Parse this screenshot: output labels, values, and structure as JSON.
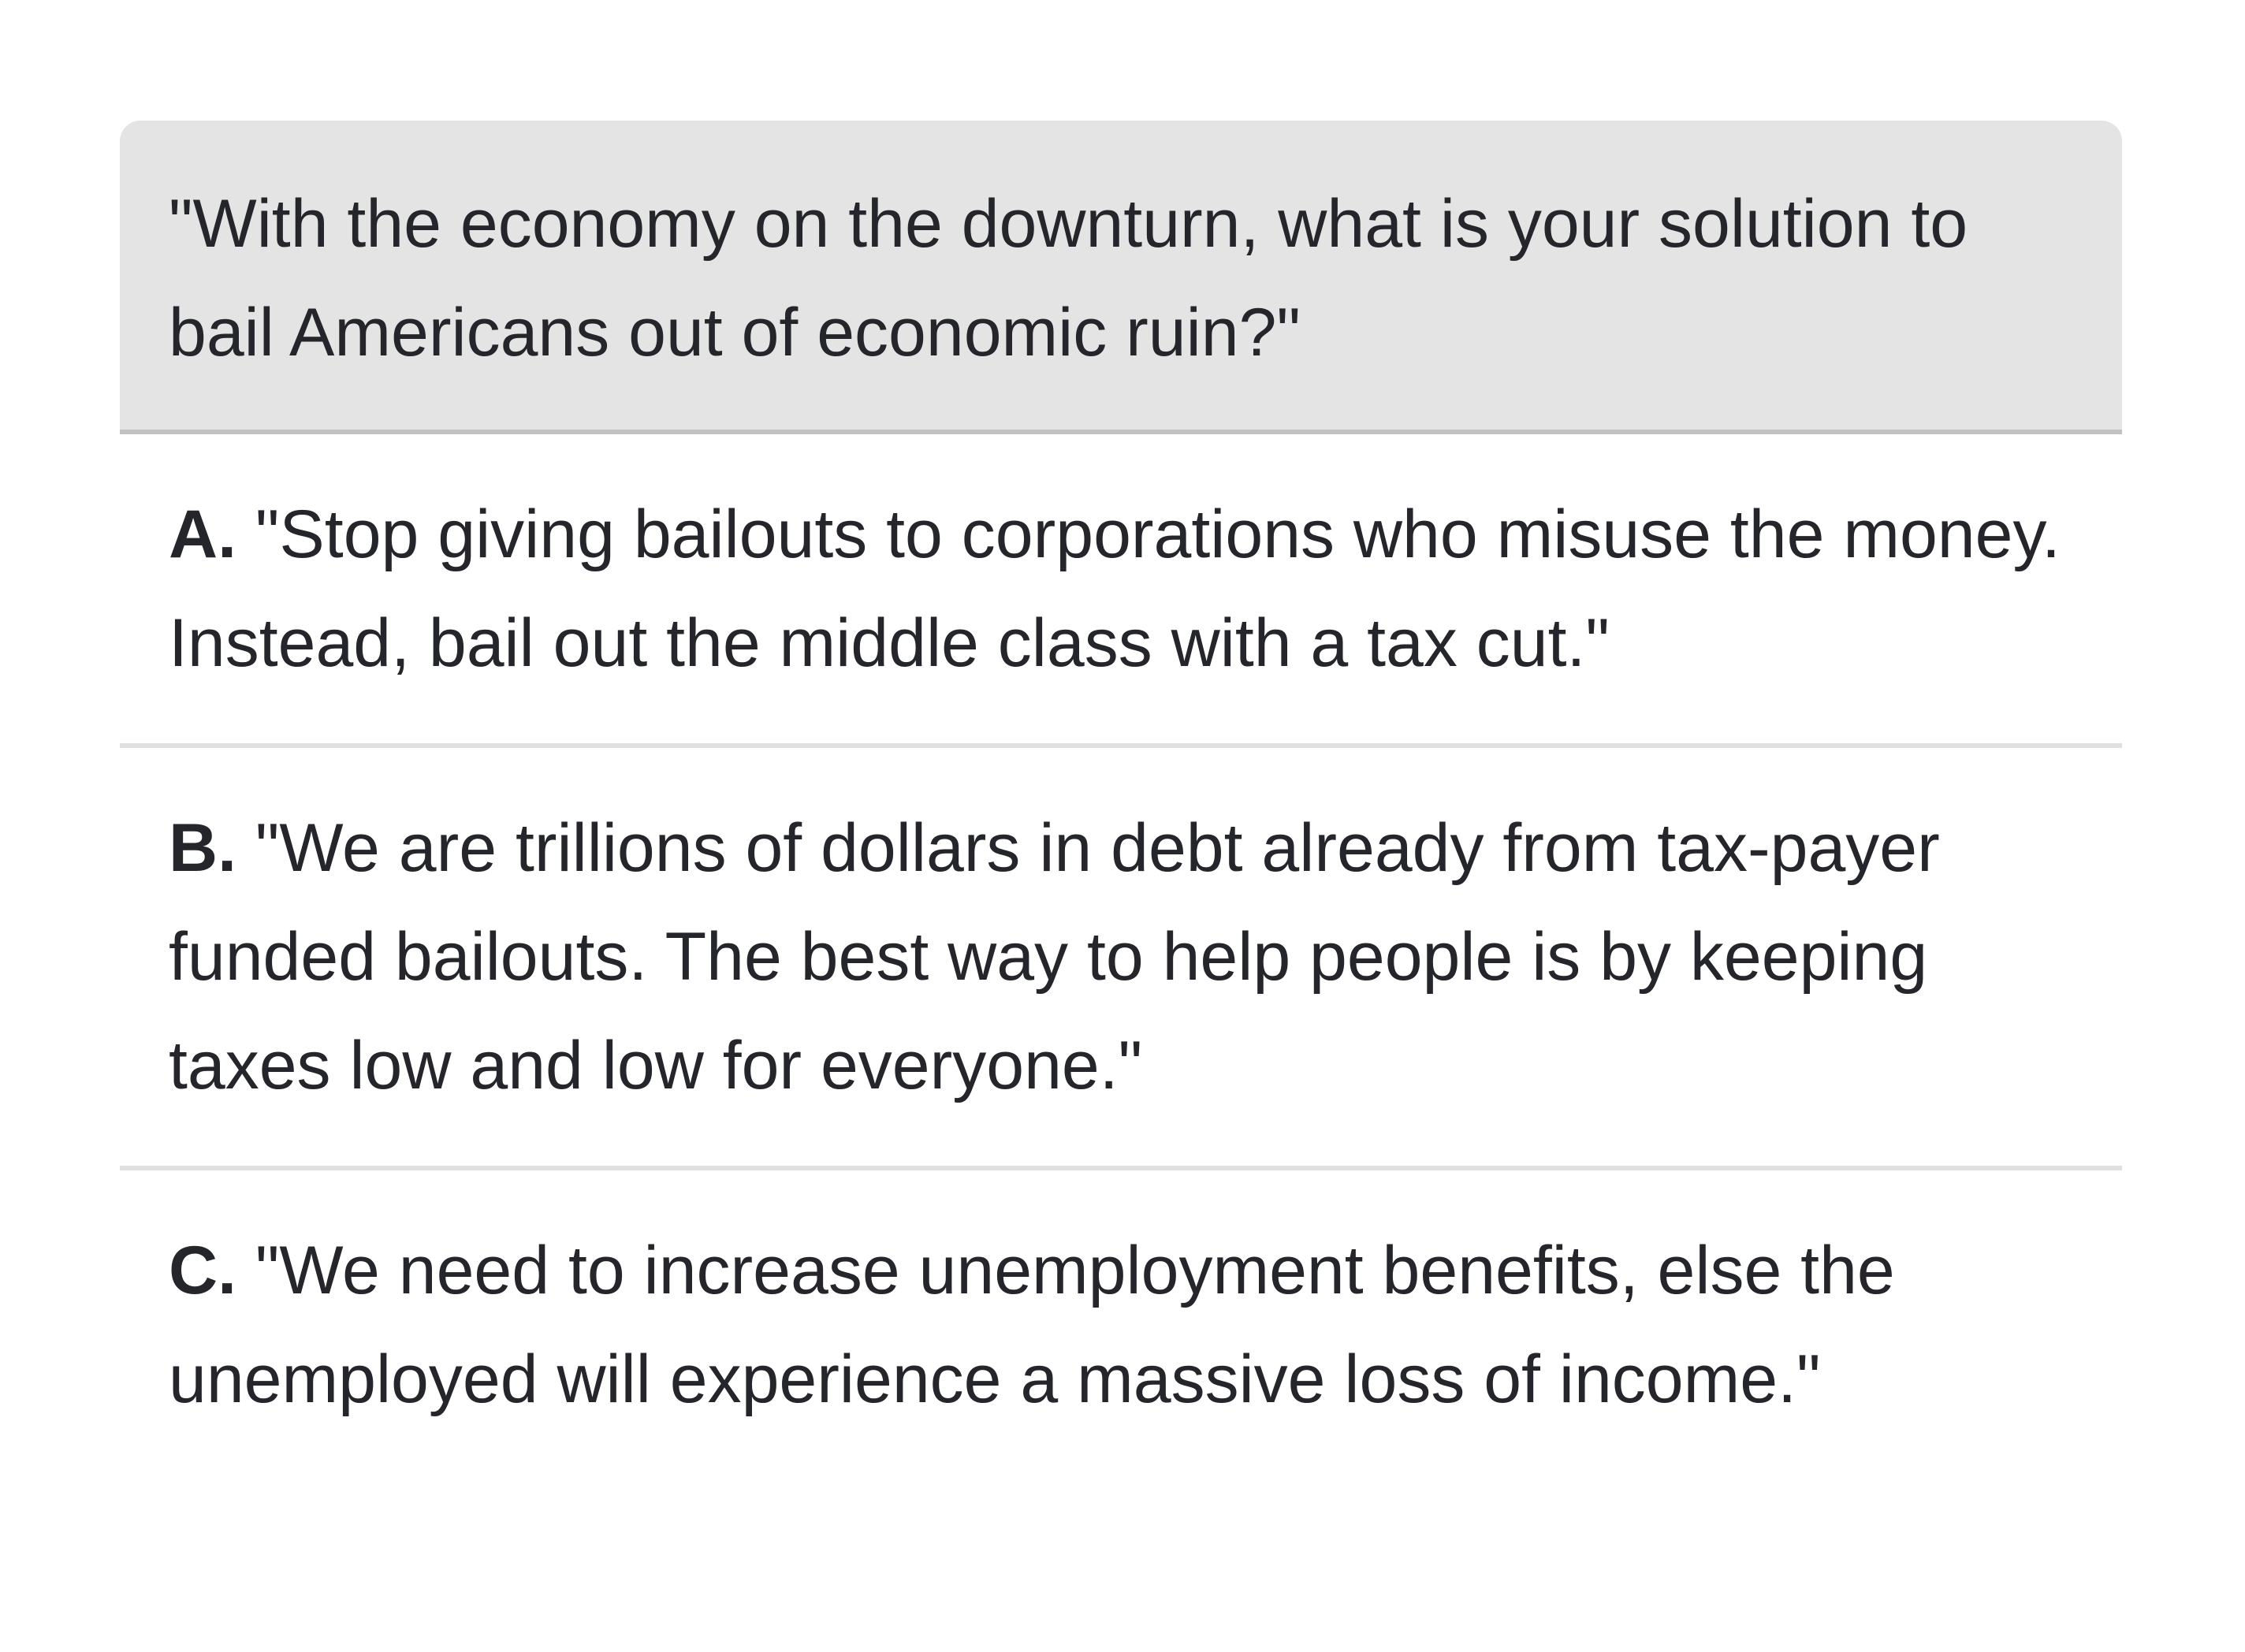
{
  "question": {
    "text": "\"With the economy on the downturn, what is your solution to bail Americans out of economic ruin?\""
  },
  "answers": [
    {
      "letter": "A.",
      "text": "\"Stop giving bailouts to corporations who misuse the money. Instead, bail out the middle class with a tax cut.\""
    },
    {
      "letter": "B.",
      "text": "\"We are trillions of dollars in debt already from tax-payer funded bailouts. The best way to help people is by keeping taxes low and low for everyone.\""
    },
    {
      "letter": "C.",
      "text": "\"We need to increase unemployment benefits, else the unemployed will experience a massive loss of income.\""
    }
  ]
}
